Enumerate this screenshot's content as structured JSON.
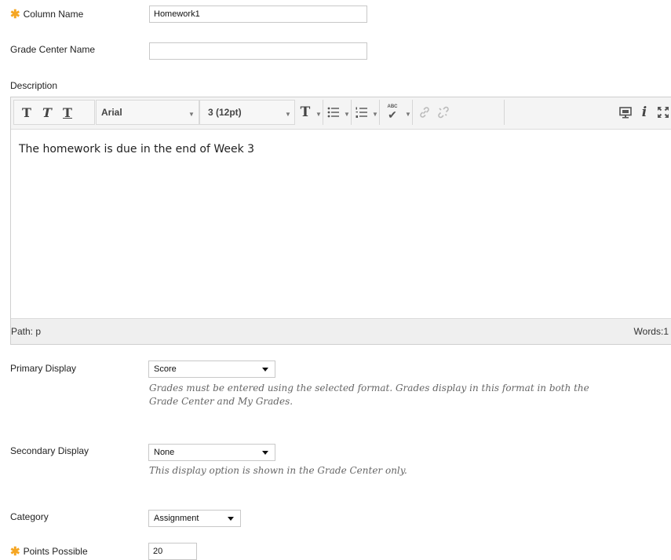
{
  "form": {
    "column_name": {
      "label": "Column Name",
      "value": "Homework1",
      "required": true
    },
    "grade_center_name": {
      "label": "Grade Center Name",
      "value": ""
    },
    "description": {
      "label": "Description",
      "toolbar": {
        "bold": "T",
        "italic": "T",
        "underline": "T",
        "font_family": "Arial",
        "font_size": "3 (12pt)",
        "text_color": "T",
        "spellcheck": "ABC"
      },
      "content": "The homework is due in the end of Week 3",
      "path_label": "Path: p",
      "words_label": "Words:1"
    },
    "primary_display": {
      "label": "Primary Display",
      "selected": "Score",
      "hint_line1": "Grades must be entered using the selected format. Grades display in this format in both the",
      "hint_line2": "Grade Center and My Grades."
    },
    "secondary_display": {
      "label": "Secondary Display",
      "selected": "None",
      "hint": "This display option is shown in the Grade Center only."
    },
    "category": {
      "label": "Category",
      "selected": "Assignment"
    },
    "points_possible": {
      "label": "Points Possible",
      "value": "20",
      "required": true
    }
  },
  "colors": {
    "required": "#f5a623",
    "hint_text": "#666666",
    "toolbar_bg": "#f4f4f4",
    "statusbar_bg": "#efefef"
  },
  "icons": [
    "required-asterisk-icon",
    "bold-icon",
    "italic-icon",
    "underline-icon",
    "text-color-icon",
    "bullet-list-icon",
    "numbered-list-icon",
    "spellcheck-icon",
    "link-icon",
    "unlink-icon",
    "preview-icon",
    "info-icon",
    "fullscreen-icon"
  ]
}
